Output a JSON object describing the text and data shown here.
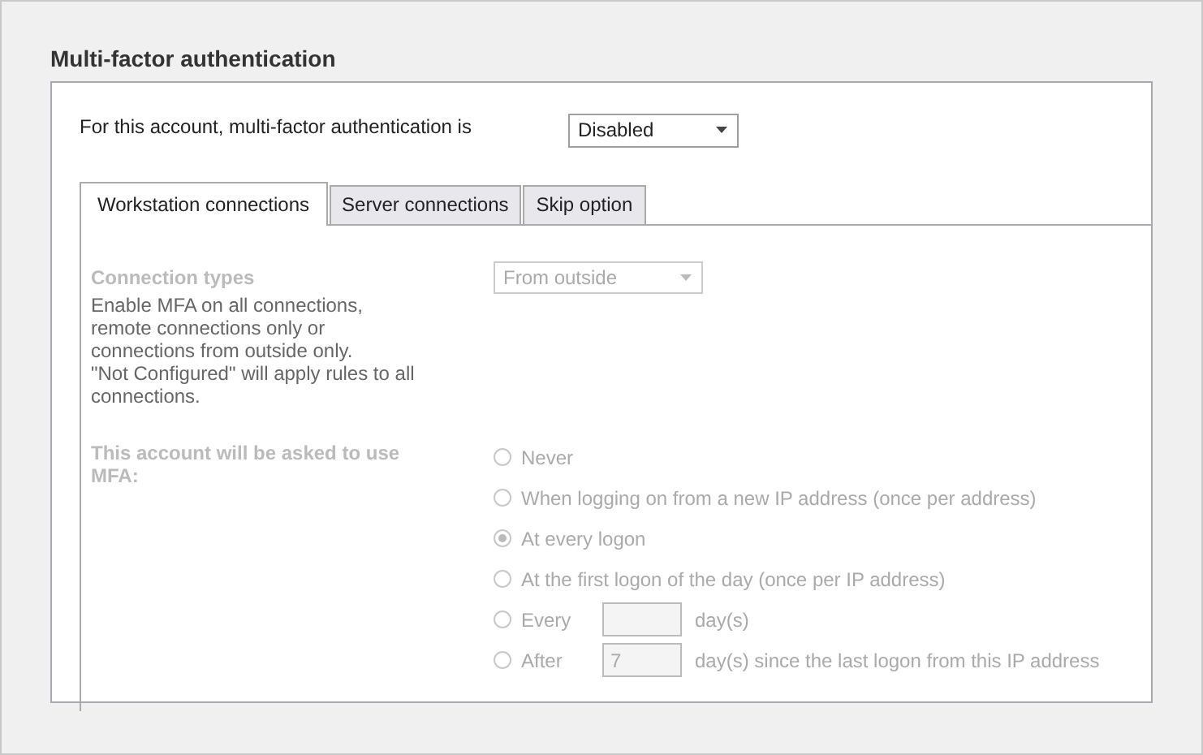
{
  "heading": "Multi-factor authentication",
  "mfa_setting": {
    "label": "For this account, multi-factor authentication is",
    "value": "Disabled"
  },
  "tabs": [
    {
      "label": "Workstation connections",
      "selected": true
    },
    {
      "label": "Server connections",
      "selected": false
    },
    {
      "label": "Skip option",
      "selected": false
    }
  ],
  "panel": {
    "disabled": true,
    "connection_types": {
      "label": "Connection types",
      "description": "Enable MFA on all connections, remote connections only or connections from outside only.\n\"Not Configured\" will apply rules to all connections.",
      "value": "From outside"
    },
    "ask_label": "This account will be asked to use MFA:",
    "options": [
      {
        "kind": "plain",
        "label": "Never",
        "selected": false
      },
      {
        "kind": "plain",
        "label": "When logging on from a new IP address (once per address)",
        "selected": false
      },
      {
        "kind": "plain",
        "label": "At every logon",
        "selected": true
      },
      {
        "kind": "plain",
        "label": "At the first logon of the day (once per IP address)",
        "selected": false
      },
      {
        "kind": "days",
        "label": "Every",
        "unit": "day(s)",
        "selected": false
      },
      {
        "kind": "days",
        "label": "After",
        "value": "7",
        "unit": "day(s) since the last logon from this IP address",
        "selected": false
      }
    ]
  }
}
